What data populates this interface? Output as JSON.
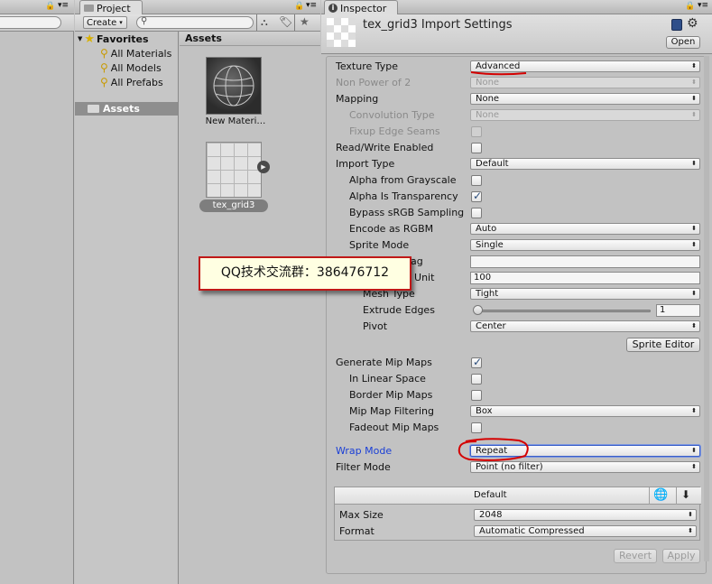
{
  "project": {
    "tab_label": "Project",
    "create_label": "Create",
    "search_placeholder": "",
    "favorites": {
      "header": "Favorites",
      "items": [
        "All Materials",
        "All Models",
        "All Prefabs"
      ]
    },
    "assets_folder_label": "Assets",
    "grid_header": "Assets",
    "assets": [
      {
        "name": "New Materi…",
        "icon": "material-sphere-icon"
      },
      {
        "name": "tex_grid3",
        "icon": "grid-texture-icon",
        "selected": true
      }
    ]
  },
  "inspector": {
    "tab_label": "Inspector",
    "title": "tex_grid3 Import Settings",
    "open_label": "Open",
    "properties": {
      "texture_type": {
        "label": "Texture Type",
        "value": "Advanced"
      },
      "non_power_of_2": {
        "label": "Non Power of 2",
        "value": "None"
      },
      "mapping": {
        "label": "Mapping",
        "value": "None"
      },
      "convolution_type": {
        "label": "Convolution Type",
        "value": "None"
      },
      "fixup_edge_seams": {
        "label": "Fixup Edge Seams"
      },
      "read_write": {
        "label": "Read/Write Enabled"
      },
      "import_type": {
        "label": "Import Type",
        "value": "Default"
      },
      "alpha_from_grayscale": {
        "label": "Alpha from Grayscale"
      },
      "alpha_is_transparency": {
        "label": "Alpha Is Transparency"
      },
      "bypass_srgb": {
        "label": "Bypass sRGB Sampling"
      },
      "encode_as_rgbm": {
        "label": "Encode as RGBM",
        "value": "Auto"
      },
      "sprite_mode": {
        "label": "Sprite Mode",
        "value": "Single"
      },
      "packing_tag": {
        "label_fragment": "ag",
        "value": ""
      },
      "pixels_per_unit": {
        "label_fragment": "r Unit",
        "value": "100"
      },
      "mesh_type": {
        "label": "Mesh Type",
        "value": "Tight"
      },
      "extrude_edges": {
        "label": "Extrude Edges",
        "value": "1",
        "slider_fraction": 0.02
      },
      "pivot": {
        "label": "Pivot",
        "value": "Center"
      },
      "sprite_editor_label": "Sprite Editor",
      "generate_mip_maps": {
        "label": "Generate Mip Maps"
      },
      "in_linear_space": {
        "label": "In Linear Space"
      },
      "border_mip_maps": {
        "label": "Border Mip Maps"
      },
      "mip_map_filtering": {
        "label": "Mip Map Filtering",
        "value": "Box"
      },
      "fadeout_mip_maps": {
        "label": "Fadeout Mip Maps"
      },
      "wrap_mode": {
        "label": "Wrap Mode",
        "value": "Repeat"
      },
      "filter_mode": {
        "label": "Filter Mode",
        "value": "Point (no filter)"
      }
    },
    "platform": {
      "header": "Default",
      "max_size": {
        "label": "Max Size",
        "value": "2048"
      },
      "format": {
        "label": "Format",
        "value": "Automatic Compressed"
      }
    },
    "revert_label": "Revert",
    "apply_label": "Apply"
  },
  "overlay": {
    "text": "QQ技术交流群：386476712"
  },
  "colors": {
    "annotation_red": "#d40000",
    "wrap_label_blue": "#1a3fd6",
    "overlay_bg": "#ffffe2"
  }
}
